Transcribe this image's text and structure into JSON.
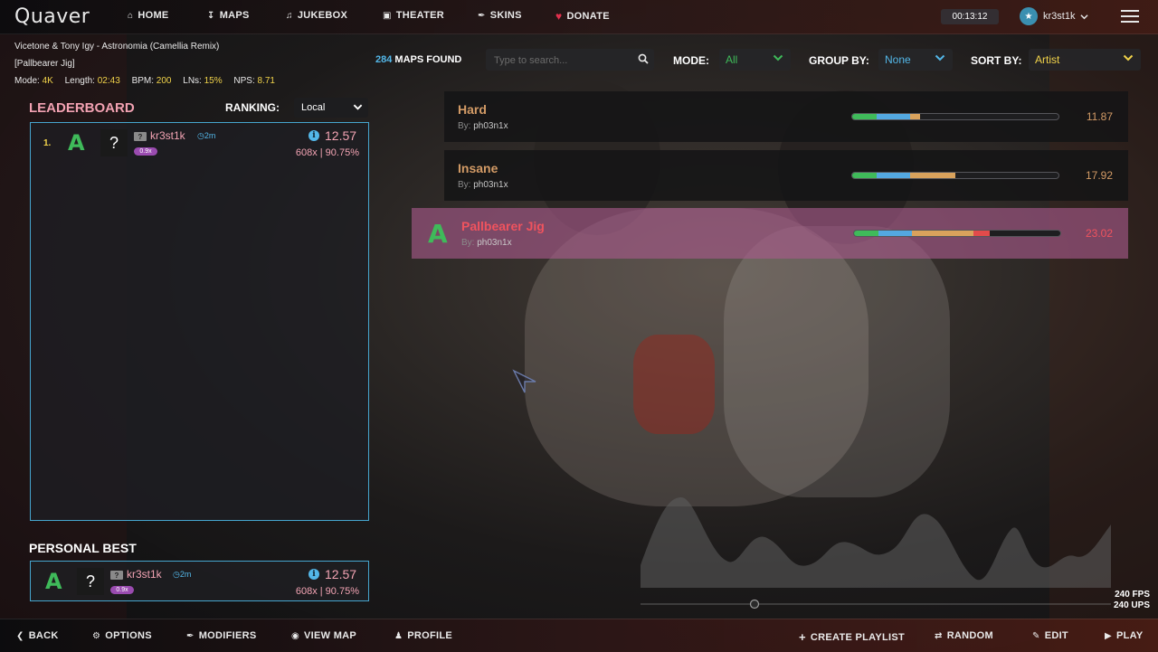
{
  "app": {
    "logo": "Quaver"
  },
  "nav": {
    "home": "HOME",
    "maps": "MAPS",
    "jukebox": "JUKEBOX",
    "theater": "THEATER",
    "skins": "SKINS",
    "donate": "DONATE"
  },
  "session": {
    "timer": "00:13:12",
    "username": "kr3st1k"
  },
  "song": {
    "title": "Vicetone & Tony Igy - Astronomia (Camellia Remix)",
    "difficulty": "[Pallbearer Jig]",
    "mode_label": "Mode:",
    "mode": "4K",
    "length_label": "Length:",
    "length": "02:43",
    "bpm_label": "BPM:",
    "bpm": "200",
    "lns_label": "LNs:",
    "lns": "15%",
    "nps_label": "NPS:",
    "nps": "8.71"
  },
  "filters": {
    "maps_count": "284",
    "maps_found": "MAPS FOUND",
    "search_placeholder": "Type to search...",
    "mode_label": "MODE:",
    "mode_value": "All",
    "group_label": "GROUP BY:",
    "group_value": "None",
    "sort_label": "SORT BY:",
    "sort_value": "Artist"
  },
  "leaderboard": {
    "title": "LEADERBOARD",
    "ranking_label": "RANKING:",
    "ranking_value": "Local",
    "scores": [
      {
        "rank": "1.",
        "grade": "A",
        "avatar": "?",
        "flag": "?",
        "name": "kr3st1k",
        "time": "2m",
        "mods": "0.9x",
        "score": "12.57",
        "stats": "608x | 90.75%"
      }
    ]
  },
  "personal_best": {
    "title": "PERSONAL BEST",
    "grade": "A",
    "avatar": "?",
    "flag": "?",
    "name": "kr3st1k",
    "time": "2m",
    "mods": "0.9x",
    "score": "12.57",
    "stats": "608x | 90.75%"
  },
  "difficulties": [
    {
      "name": "Hard",
      "by_label": "By:",
      "creator": "ph03n1x",
      "rating": "11.87",
      "rating_fraction": 0.33,
      "color": "#d39b66",
      "selected": false
    },
    {
      "name": "Insane",
      "by_label": "By:",
      "creator": "ph03n1x",
      "rating": "17.92",
      "rating_fraction": 0.5,
      "color": "#d39b66",
      "selected": false
    },
    {
      "name": "Pallbearer Jig",
      "by_label": "By:",
      "creator": "ph03n1x",
      "rating": "23.02",
      "rating_fraction": 0.66,
      "color": "#f0535e",
      "grade": "A",
      "selected": true
    }
  ],
  "performance": {
    "fps": "240 FPS",
    "ups": "240 UPS"
  },
  "bottom": {
    "back": "BACK",
    "options": "OPTIONS",
    "modifiers": "MODIFIERS",
    "view_map": "VIEW MAP",
    "profile": "PROFILE",
    "create_playlist": "CREATE PLAYLIST",
    "random": "RANDOM",
    "edit": "EDIT",
    "play": "PLAY"
  },
  "colors": {
    "accent_blue": "#53b7e8",
    "accent_pink": "#f3a4b4",
    "grade_green": "#3fba5a",
    "stat_yellow": "#f1d34a"
  }
}
